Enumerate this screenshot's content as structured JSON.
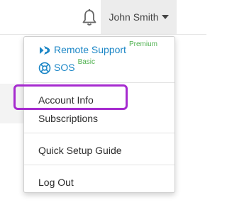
{
  "header": {
    "notifications_icon": "bell-icon",
    "user_name": "John Smith",
    "caret_icon": "caret-down-icon"
  },
  "dropdown": {
    "products": [
      {
        "name": "Remote Support",
        "tier": "Premium",
        "icon": "remote-support-icon"
      },
      {
        "name": "SOS",
        "tier": "Basic",
        "icon": "sos-icon"
      }
    ],
    "items": [
      "Account Info",
      "Subscriptions",
      "Quick Setup Guide",
      "Log Out"
    ]
  },
  "colors": {
    "link_blue": "#1b86c6",
    "tier_green": "#4fb14f",
    "highlight_purple": "#a62bcf"
  }
}
